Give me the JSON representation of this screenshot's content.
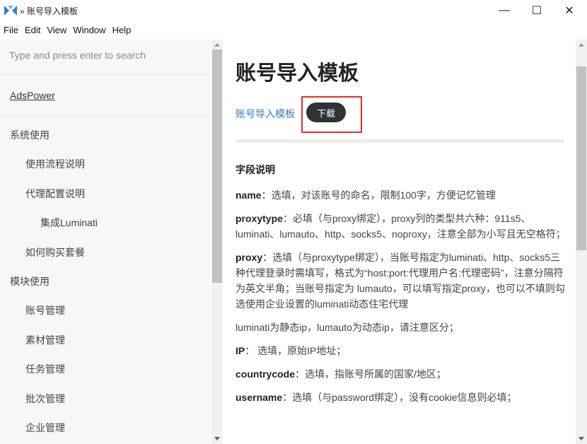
{
  "window": {
    "title": "» 账号导入模板",
    "controls": {
      "minimize": "—",
      "maximize": "☐",
      "close": "✕"
    }
  },
  "menu": [
    "File",
    "Edit",
    "View",
    "Window",
    "Help"
  ],
  "sidebar": {
    "search_placeholder": "Type and press enter to search",
    "brand": "AdsPower",
    "items": [
      {
        "label": "系统使用",
        "level": 0
      },
      {
        "label": "使用流程说明",
        "level": 1
      },
      {
        "label": "代理配置说明",
        "level": 1
      },
      {
        "label": "集成Luminati",
        "level": 2
      },
      {
        "label": "如何购买套餐",
        "level": 1
      },
      {
        "label": "模块使用",
        "level": 0
      },
      {
        "label": "账号管理",
        "level": 1
      },
      {
        "label": "素材管理",
        "level": 1
      },
      {
        "label": "任务管理",
        "level": 1
      },
      {
        "label": "批次管理",
        "level": 1
      },
      {
        "label": "企业管理",
        "level": 1
      }
    ]
  },
  "main": {
    "title": "账号导入模板",
    "template_link": "账号导入模板",
    "download_label": "下载",
    "section_title": "字段说明",
    "fields": [
      {
        "name": "name",
        "text": "：选填，对该账号的命名，限制100字，方便记忆管理"
      },
      {
        "name": "proxytype",
        "text": "：必填（与proxy绑定），proxy列的类型共六种：911s5、luminati、lumauto、http、socks5、noproxy，注意全部为小写且无空格符；"
      },
      {
        "name": "proxy",
        "text": "：选填（与proxytype绑定），当账号指定为luminati、http、socks5三种代理登录时需填写，格式为“host:port:代理用户名:代理密码”，注意分隔符为英文半角；当账号指定为 lumauto，可以填写指定proxy，也可以不填则勾选使用企业设置的luminati动态住宅代理"
      },
      {
        "name": "",
        "text": "luminati为静态ip，lumauto为动态ip，请注意区分；"
      },
      {
        "name": "IP",
        "text": "： 选填，原始IP地址；"
      },
      {
        "name": "countrycode",
        "text": "：选填，指账号所属的国家/地区；"
      },
      {
        "name": "username",
        "text": "：选填（与password绑定），没有cookie信息则必填；"
      }
    ]
  },
  "colors": {
    "accent_link": "#3b7bbf",
    "button_bg": "#2f3336",
    "highlight_border": "#e0302a",
    "sidebar_bg": "#f7f7f7"
  }
}
